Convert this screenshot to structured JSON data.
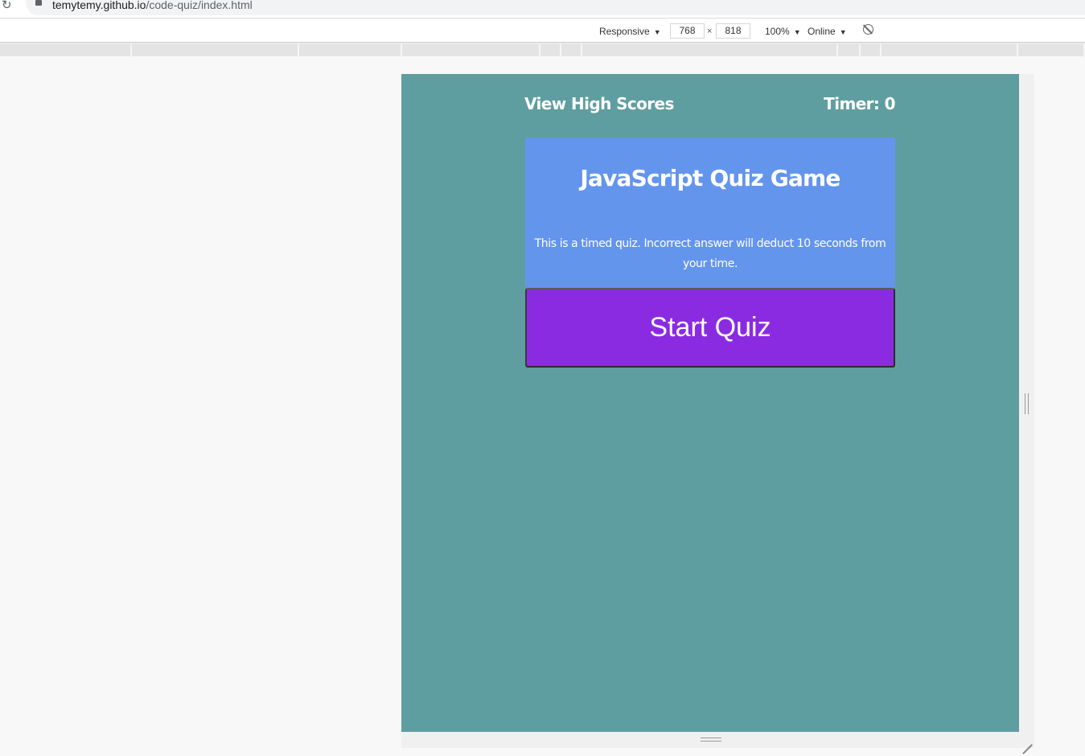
{
  "browser": {
    "url_host": "temytemy.github.io",
    "url_path": "/code-quiz/index.html"
  },
  "device_toolbar": {
    "device_mode": "Responsive",
    "width": "768",
    "height": "818",
    "dimension_separator": "×",
    "zoom": "100%",
    "throttling": "Online",
    "caret": "▼"
  },
  "quiz_page": {
    "colors": {
      "page_background": "#5f9ea0",
      "card_background": "#6495ed",
      "button_background": "#8a2be2",
      "text": "#ffffff"
    },
    "header": {
      "high_scores_label": "View High Scores",
      "timer_label": "Timer: 0"
    },
    "card": {
      "title": "JavaScript Quiz Game",
      "description": "This is a timed quiz. Incorrect answer will deduct 10 seconds from your time."
    },
    "start_button_label": "Start Quiz"
  }
}
